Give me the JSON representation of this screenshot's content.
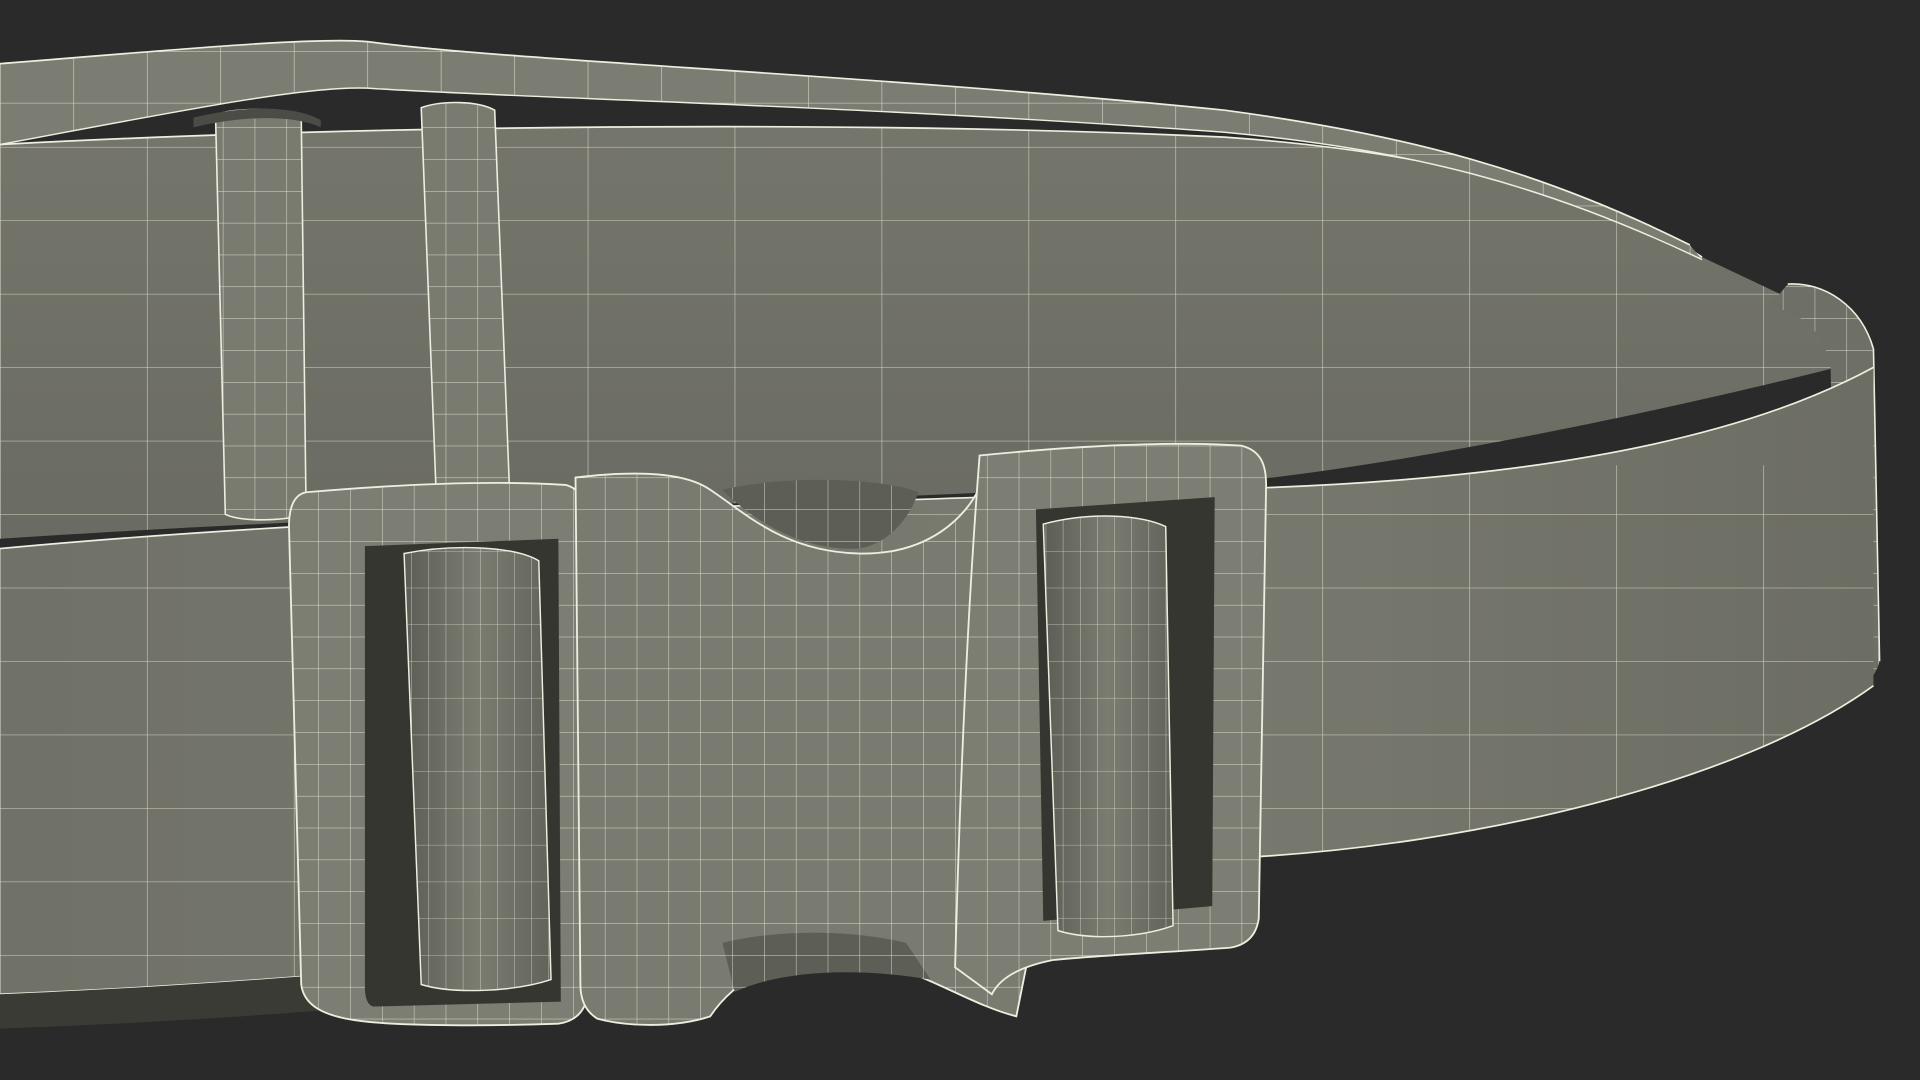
{
  "scene": {
    "subject": "belt-with-side-release-buckle",
    "render_style": "wireframe-over-clay",
    "colors": {
      "background": "#2a2a2a",
      "clay_light": "#7f8074",
      "clay_mid": "#73746a",
      "clay_dark": "#5f6058",
      "shadow": "#35362f",
      "wire": "#eeeedf"
    }
  }
}
